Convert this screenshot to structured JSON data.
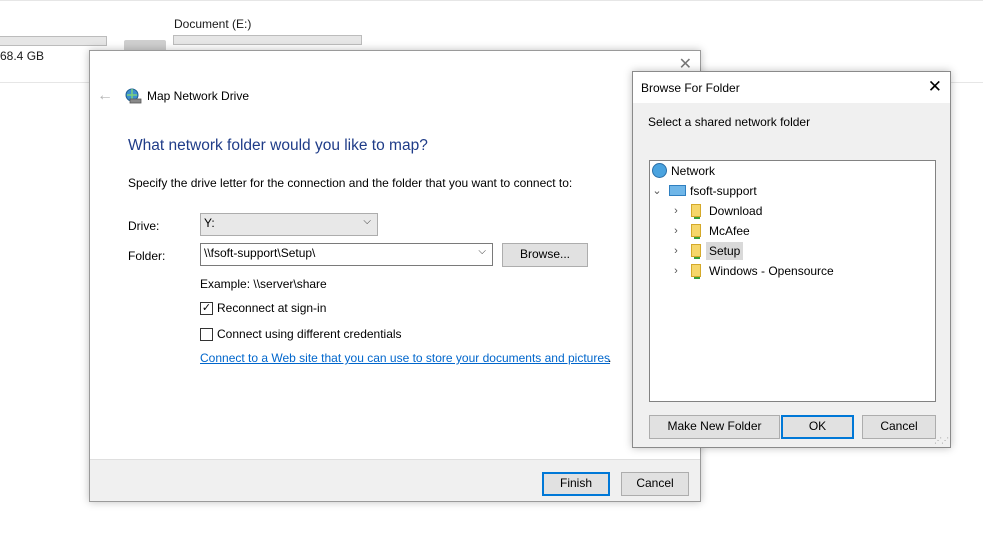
{
  "background": {
    "drive_name": "Document (E:)",
    "left_capacity": "68.4 GB"
  },
  "map_drive": {
    "title": "Map Network Drive",
    "heading": "What network folder would you like to map?",
    "instruction": "Specify the drive letter for the connection and the folder that you want to connect to:",
    "drive_label": "Drive:",
    "drive_value": "Y:",
    "folder_label": "Folder:",
    "folder_value": "\\\\fsoft-support\\Setup\\",
    "browse_label": "Browse...",
    "example": "Example: \\\\server\\share",
    "reconnect_label": "Reconnect at sign-in",
    "reconnect_checked": true,
    "credentials_label": "Connect using different credentials",
    "credentials_checked": false,
    "web_link": "Connect to a Web site that you can use to store your documents and pictures",
    "web_link_suffix": ".",
    "finish_label": "Finish",
    "cancel_label": "Cancel",
    "accent": "#0078d7",
    "heading_color": "#1f3c88"
  },
  "browse_folder": {
    "title": "Browse For Folder",
    "description": "Select a shared network folder",
    "tree": {
      "root": "Network",
      "computer": "fsoft-support",
      "folders": [
        "Download",
        "McAfee",
        "Setup",
        "Windows - Opensource"
      ],
      "selected": "Setup"
    },
    "new_folder_label": "Make New Folder",
    "ok_label": "OK",
    "cancel_label": "Cancel"
  }
}
